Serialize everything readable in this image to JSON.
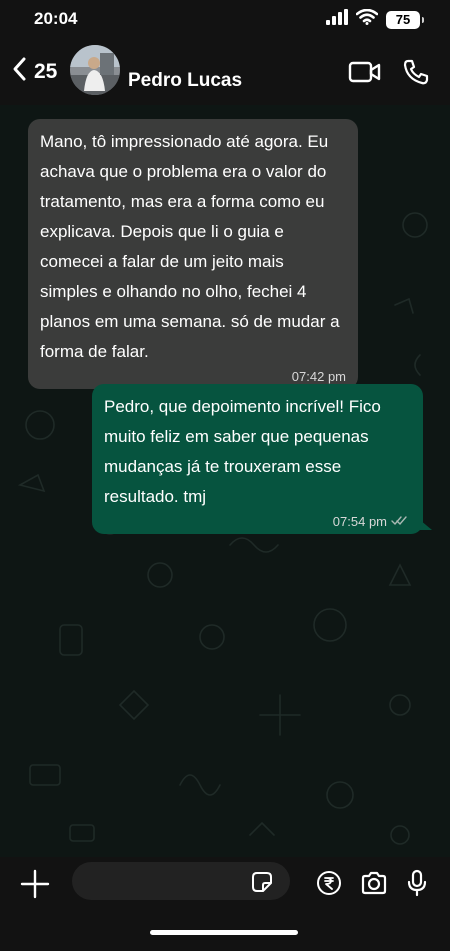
{
  "status_bar": {
    "time": "20:04",
    "battery": "75"
  },
  "header": {
    "back_count": "25",
    "contact_name": "Pedro Lucas",
    "icons": [
      "chevron-left-icon",
      "video-call-icon",
      "phone-icon"
    ]
  },
  "messages": [
    {
      "direction": "incoming",
      "text": " Mano, tô impressionado até agora. Eu achava que o problema era o valor do tratamento, mas era a forma como eu explicava. Depois que li o guia e comecei a falar de um jeito mais simples e olhando no olho, fechei 4 planos em uma semana. só de mudar a forma de falar.",
      "time": "07:42 pm"
    },
    {
      "direction": "outgoing",
      "text": " Pedro, que depoimento incrível! Fico muito feliz em saber que pequenas mudanças já te trouxeram esse resultado. tmj",
      "time": "07:54 pm",
      "status": "delivered"
    }
  ],
  "composer": {
    "placeholder": "",
    "icons": [
      "plus-icon",
      "sticker-icon",
      "rupee-payment-icon",
      "camera-icon",
      "microphone-icon"
    ]
  },
  "colors": {
    "incoming_bubble": "#3b3c3b",
    "outgoing_bubble": "#06543f",
    "chat_background": "#0e1614"
  }
}
